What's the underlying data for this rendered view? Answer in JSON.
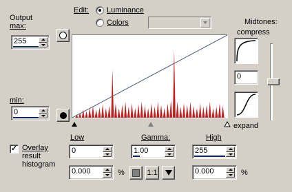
{
  "output": {
    "max_label_line1": "Output",
    "max_label_line2": "max:",
    "max_value": "255",
    "min_label": "min:",
    "min_value": "0"
  },
  "edit": {
    "label": "Edit:",
    "luminance_label": "Luminance",
    "colors_label": "Colors",
    "selected": "Luminance",
    "channel_value": ""
  },
  "midtones": {
    "label": "Midtones:",
    "compress_label": "compress",
    "value": "0",
    "expand_label": "expand",
    "slider_level": 0.5
  },
  "overlay": {
    "label_line1": "Overlay",
    "label_line2": "result",
    "label_line3": "histogram",
    "checked": true
  },
  "input": {
    "low_label": "Low",
    "low_value": "0",
    "gamma_label": "Gamma:",
    "gamma_value": "1.00",
    "high_label": "High",
    "high_value": "255",
    "low_percent": "0.000",
    "high_percent": "0.000",
    "percent_sign": "%",
    "one_to_one_label": "1:1"
  },
  "histogram": {
    "bar_color": "#c81e1e",
    "line_color": "#505a78",
    "levels": [
      0.04,
      0.06,
      0.1,
      0.08,
      0.12,
      0.15,
      0.1,
      0.13,
      0.17,
      0.12,
      0.15,
      0.6,
      0.18,
      0.12,
      0.16,
      0.2,
      0.14,
      0.18,
      0.12,
      0.17,
      0.2,
      0.15,
      0.12,
      0.18,
      0.14,
      0.2,
      0.16,
      0.12,
      0.18,
      0.22,
      0.86,
      0.2,
      0.14,
      0.18,
      0.16,
      0.2,
      0.15,
      0.12,
      0.18,
      0.14,
      0.16,
      0.2,
      0.12,
      0.14,
      0.18,
      0.15
    ]
  }
}
